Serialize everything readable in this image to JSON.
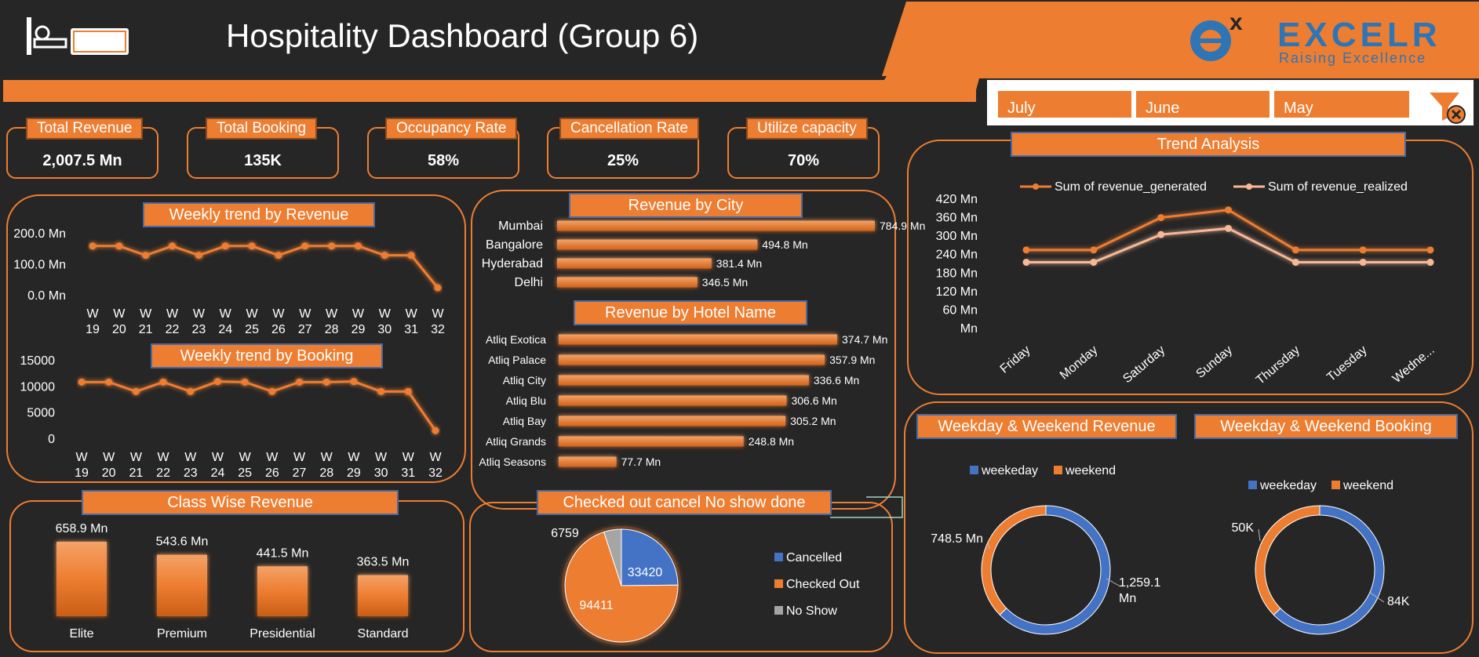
{
  "header": {
    "title": "Hospitality Dashboard (Group 6)",
    "brand_name": "EXCELR",
    "brand_tagline": "Raising Excellence",
    "accent": "#ed7d31",
    "blue": "#4472c4"
  },
  "filters": [
    "July",
    "June",
    "May"
  ],
  "kpis": {
    "revenue": {
      "label": "Total Revenue",
      "value": "2,007.5 Mn"
    },
    "booking": {
      "label": "Total Booking",
      "value": "135K"
    },
    "occupancy": {
      "label": "Occupancy Rate",
      "value": "58%"
    },
    "cancellation": {
      "label": "Cancellation Rate",
      "value": "25%"
    },
    "utilize": {
      "label": "Utilize capacity",
      "value": "70%"
    }
  },
  "titles": {
    "weekly_revenue": "Weekly trend by Revenue",
    "weekly_booking": "Weekly trend by Booking",
    "revenue_city": "Revenue by City",
    "revenue_hotel": "Revenue by Hotel Name",
    "trend": "Trend Analysis",
    "class_revenue": "Class Wise Revenue",
    "status": "Checked out cancel No show done",
    "wk_revenue": "Weekday  & Weekend  Revenue",
    "wk_booking": "Weekday  & Weekend  Booking"
  },
  "chart_data": [
    {
      "id": "weekly_revenue",
      "type": "line",
      "title": "Weekly trend by Revenue",
      "categories": [
        "W 19",
        "W 20",
        "W 21",
        "W 22",
        "W 23",
        "W 24",
        "W 25",
        "W 26",
        "W 27",
        "W 28",
        "W 29",
        "W 30",
        "W 31",
        "W 32"
      ],
      "values": [
        160,
        160,
        130,
        160,
        130,
        160,
        160,
        130,
        160,
        160,
        160,
        130,
        130,
        25
      ],
      "yticks": [
        "200.0 Mn",
        "100.0 Mn",
        "0.0 Mn"
      ],
      "ylim": [
        0,
        200
      ]
    },
    {
      "id": "weekly_booking",
      "type": "line",
      "title": "Weekly trend by Booking",
      "categories": [
        "W 19",
        "W 20",
        "W 21",
        "W 22",
        "W 23",
        "W 24",
        "W 25",
        "W 26",
        "W 27",
        "W 28",
        "W 29",
        "W 30",
        "W 31",
        "W 32"
      ],
      "values": [
        10900,
        10900,
        9100,
        10900,
        9100,
        11000,
        10900,
        9100,
        10900,
        10900,
        11000,
        9100,
        9100,
        1600
      ],
      "yticks": [
        "15000",
        "10000",
        "5000",
        "0"
      ],
      "ylim": [
        0,
        15000
      ]
    },
    {
      "id": "revenue_city",
      "type": "bar",
      "title": "Revenue by City",
      "categories": [
        "Mumbai",
        "Bangalore",
        "Hyderabad",
        "Delhi"
      ],
      "values": [
        784.9,
        494.8,
        381.4,
        346.5
      ],
      "labels": [
        "784.9 Mn",
        "494.8 Mn",
        "381.4 Mn",
        "346.5 Mn"
      ]
    },
    {
      "id": "revenue_hotel",
      "type": "bar",
      "title": "Revenue by Hotel Name",
      "categories": [
        "Atliq Exotica",
        "Atliq Palace",
        "Atliq City",
        "Atliq Blu",
        "Atliq Bay",
        "Atliq Grands",
        "Atliq Seasons"
      ],
      "values": [
        374.7,
        357.9,
        336.6,
        306.6,
        305.2,
        248.8,
        77.7
      ],
      "labels": [
        "374.7 Mn",
        "357.9 Mn",
        "336.6 Mn",
        "306.6 Mn",
        "305.2 Mn",
        "248.8 Mn",
        "77.7 Mn"
      ]
    },
    {
      "id": "trend",
      "type": "line",
      "title": "Trend Analysis",
      "categories": [
        "Friday",
        "Monday",
        "Saturday",
        "Sunday",
        "Thursday",
        "Tuesday",
        "Wedne..."
      ],
      "yticks": [
        "420 Mn",
        "360 Mn",
        "300 Mn",
        "240 Mn",
        "180 Mn",
        "120 Mn",
        "60 Mn",
        "Mn"
      ],
      "ylim": [
        0,
        420
      ],
      "series": [
        {
          "name": "Sum of revenue_generated",
          "values": [
            255,
            255,
            360,
            385,
            255,
            255,
            255
          ]
        },
        {
          "name": "Sum of revenue_realized",
          "values": [
            215,
            215,
            305,
            325,
            215,
            215,
            215
          ]
        }
      ]
    },
    {
      "id": "class_revenue",
      "type": "bar",
      "title": "Class Wise Revenue",
      "categories": [
        "Elite",
        "Premium",
        "Presidential",
        "Standard"
      ],
      "values": [
        658.9,
        543.6,
        441.5,
        363.5
      ],
      "labels": [
        "658.9 Mn",
        "543.6 Mn",
        "441.5 Mn",
        "363.5 Mn"
      ]
    },
    {
      "id": "status",
      "type": "pie",
      "title": "Checked out cancel No show done",
      "categories": [
        "Cancelled",
        "Checked Out",
        "No Show"
      ],
      "values": [
        33420,
        94411,
        6759
      ],
      "colors": [
        "#4472c4",
        "#ed7d31",
        "#a5a5a5"
      ]
    },
    {
      "id": "wk_revenue",
      "type": "pie",
      "title": "Weekday  & Weekend  Revenue",
      "categories": [
        "weekeday",
        "weekend"
      ],
      "values": [
        1259.1,
        748.5
      ],
      "labels": [
        "1,259.1 Mn",
        "748.5 Mn"
      ],
      "colors": [
        "#4472c4",
        "#ed7d31"
      ]
    },
    {
      "id": "wk_booking",
      "type": "pie",
      "title": "Weekday  & Weekend  Booking",
      "categories": [
        "weekeday",
        "weekend"
      ],
      "values": [
        84,
        50
      ],
      "labels": [
        "84K",
        "50K"
      ],
      "colors": [
        "#4472c4",
        "#ed7d31"
      ]
    }
  ]
}
